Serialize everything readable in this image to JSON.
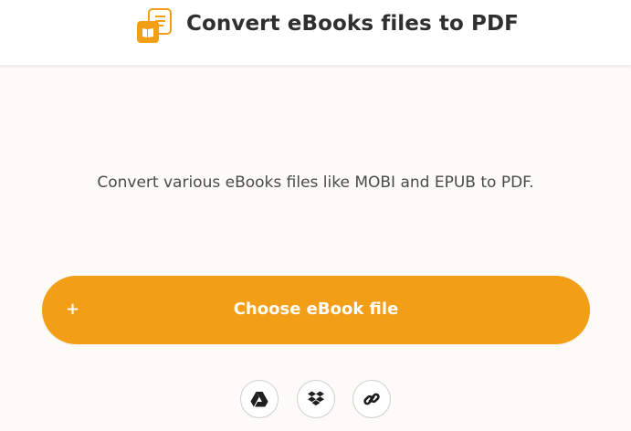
{
  "header": {
    "title": "Convert eBooks files to PDF",
    "logo_icon": "ebook-convert-icon"
  },
  "main": {
    "description": "Convert various eBooks files like MOBI and EPUB to PDF.",
    "choose_button": {
      "plus": "+",
      "label": "Choose eBook file"
    },
    "sources": [
      {
        "name": "google-drive",
        "icon": "google-drive-icon"
      },
      {
        "name": "dropbox",
        "icon": "dropbox-icon"
      },
      {
        "name": "url",
        "icon": "link-icon"
      }
    ]
  },
  "colors": {
    "accent": "#f29e16",
    "background": "#fcfbf7",
    "title": "#2f2f2f",
    "text": "#4a4a4a"
  }
}
